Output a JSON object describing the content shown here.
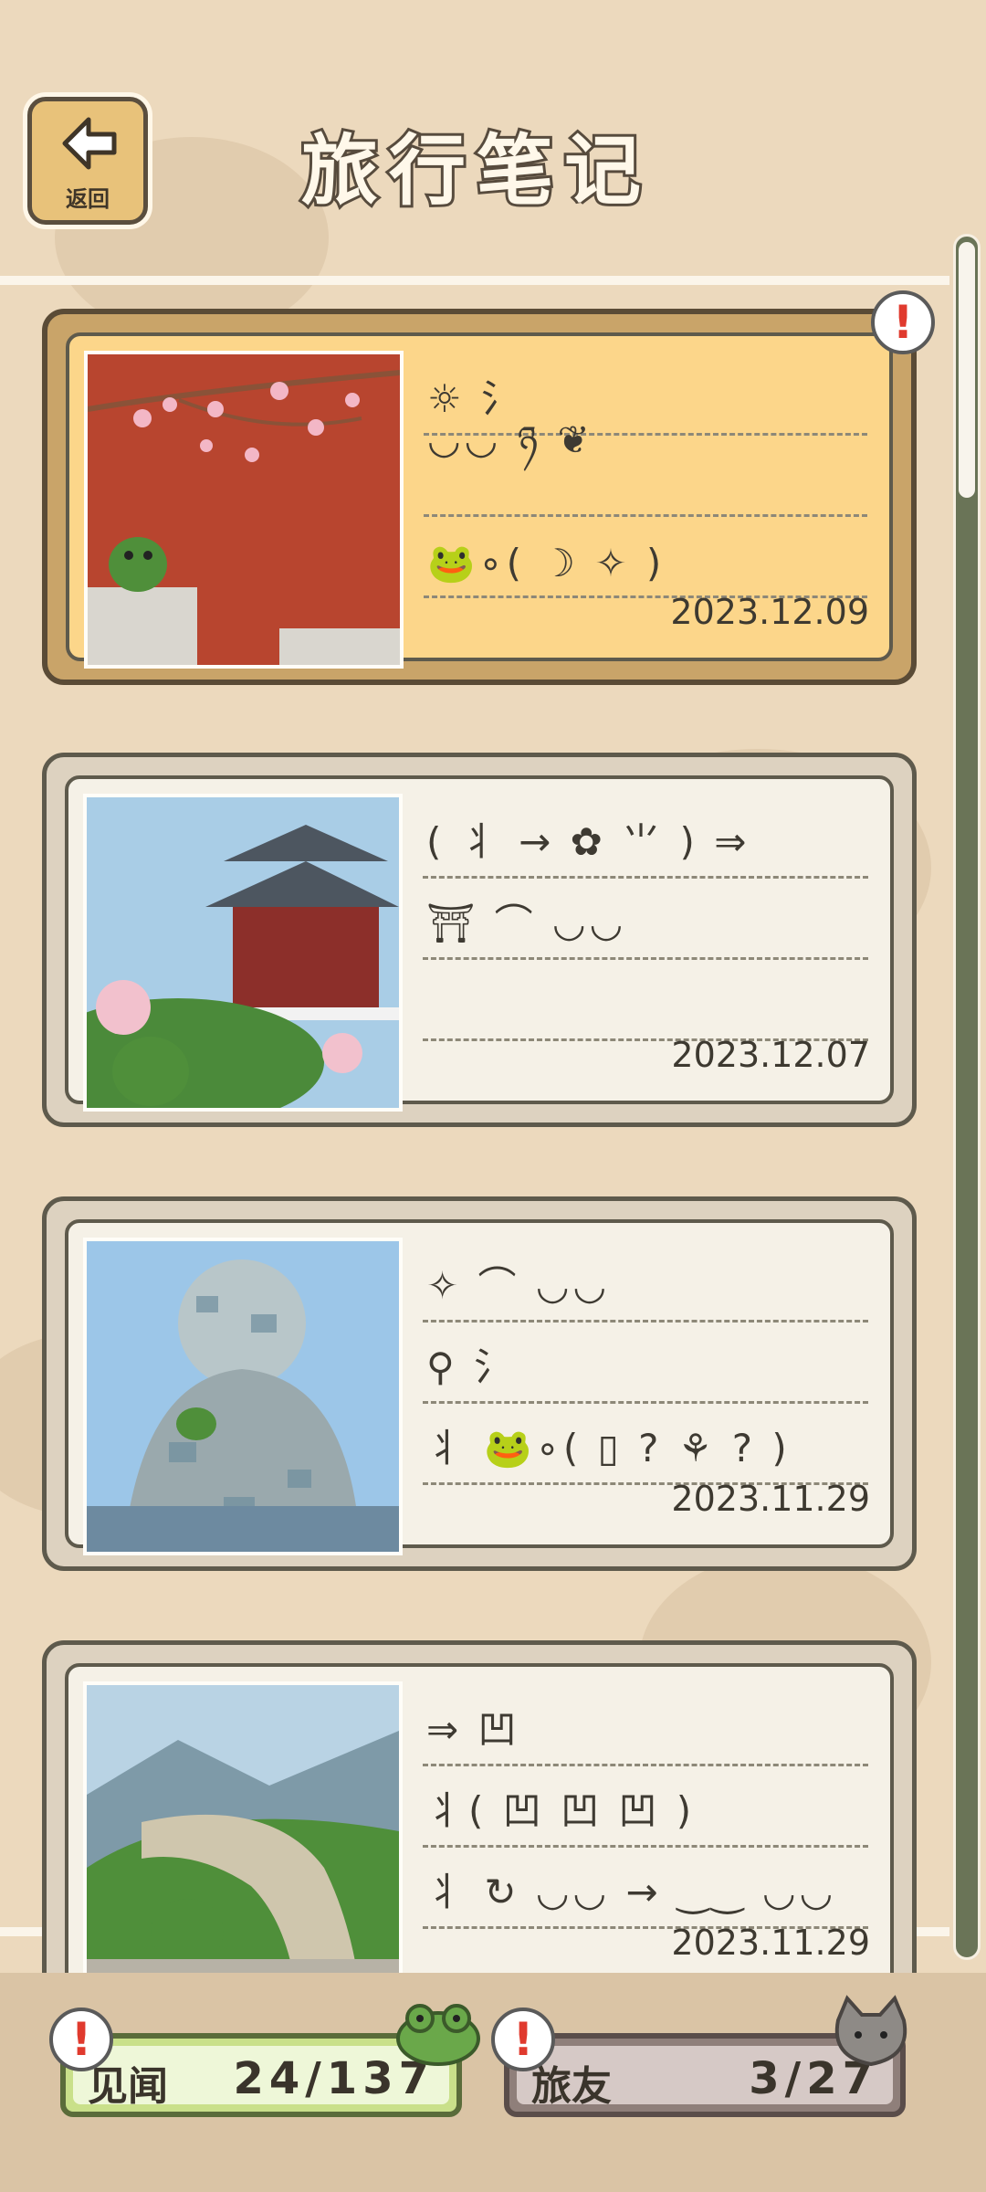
{
  "header": {
    "title": "旅行笔记",
    "back_label": "返回"
  },
  "colors": {
    "background": "#ecd9bd",
    "highlight_card": "#fcd68a",
    "plain_card": "#f5f1e7",
    "alert_red": "#e03a2e",
    "scrollbar": "#6a7457"
  },
  "notes": [
    {
      "date": "2023.12.09",
      "highlighted": true,
      "alert": "!",
      "photo_icon": "plum-blossom-frog-photo",
      "lines": [
        "☼ 氵",
        "◡◡ ཉ ❦",
        "🐸∘( ☽ ✧ )"
      ]
    },
    {
      "date": "2023.12.07",
      "highlighted": false,
      "photo_icon": "pagoda-frog-photo",
      "lines": [
        "( ⺦ → ✿ ⺌ ) ⇒",
        "⛩ ⌒ ◡◡",
        ""
      ]
    },
    {
      "date": "2023.11.29",
      "highlighted": false,
      "photo_icon": "mosaic-tower-frog-photo",
      "lines": [
        "✧ ⌒ ◡◡",
        "⚲ 氵",
        "⺦ 🐸∘( ▯ ? ⚘ ? )"
      ]
    },
    {
      "date": "2023.11.29",
      "highlighted": false,
      "photo_icon": "great-wall-frog-photo",
      "lines": [
        "⇒ 凹",
        "⺦( 凹 凹 凹 )",
        "⺦ ↻ ◡◡ → ‿‿ ◡◡"
      ]
    }
  ],
  "stats": {
    "jianwen_label": "见闻",
    "jianwen_count": "24/137",
    "lvyou_label": "旅友",
    "lvyou_count": "3/27",
    "alert": "!"
  }
}
